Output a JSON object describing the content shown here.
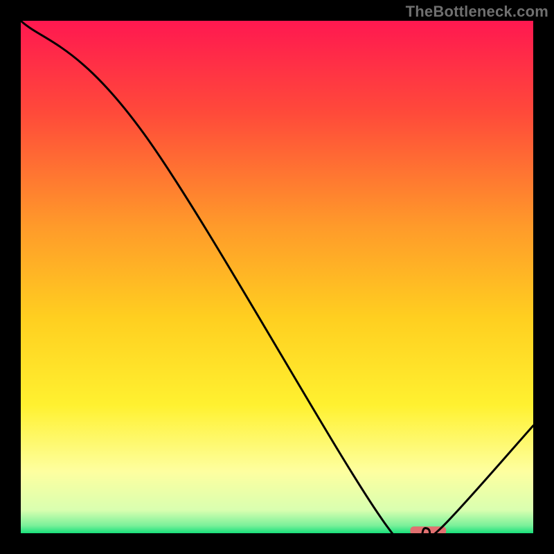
{
  "watermark": "TheBottleneck.com",
  "chart_data": {
    "type": "line",
    "title": "",
    "xlabel": "",
    "ylabel": "",
    "xlim": [
      0,
      100
    ],
    "ylim": [
      0,
      100
    ],
    "grid": false,
    "series": [
      {
        "name": "bottleneck-curve",
        "x": [
          0,
          24,
          71,
          79,
          82,
          100
        ],
        "y": [
          100,
          78,
          2,
          1,
          1,
          21
        ]
      }
    ],
    "marker": {
      "name": "highlight-segment",
      "x_range": [
        76,
        83
      ],
      "y": 0.5,
      "color": "#e17070"
    },
    "gradient_stops": [
      {
        "offset": 0.0,
        "color": "#ff1850"
      },
      {
        "offset": 0.18,
        "color": "#ff4a3a"
      },
      {
        "offset": 0.4,
        "color": "#ff9a2a"
      },
      {
        "offset": 0.58,
        "color": "#ffcf20"
      },
      {
        "offset": 0.75,
        "color": "#fff130"
      },
      {
        "offset": 0.88,
        "color": "#feffa0"
      },
      {
        "offset": 0.955,
        "color": "#d9ffb0"
      },
      {
        "offset": 0.985,
        "color": "#7af09a"
      },
      {
        "offset": 1.0,
        "color": "#18e07a"
      }
    ]
  }
}
